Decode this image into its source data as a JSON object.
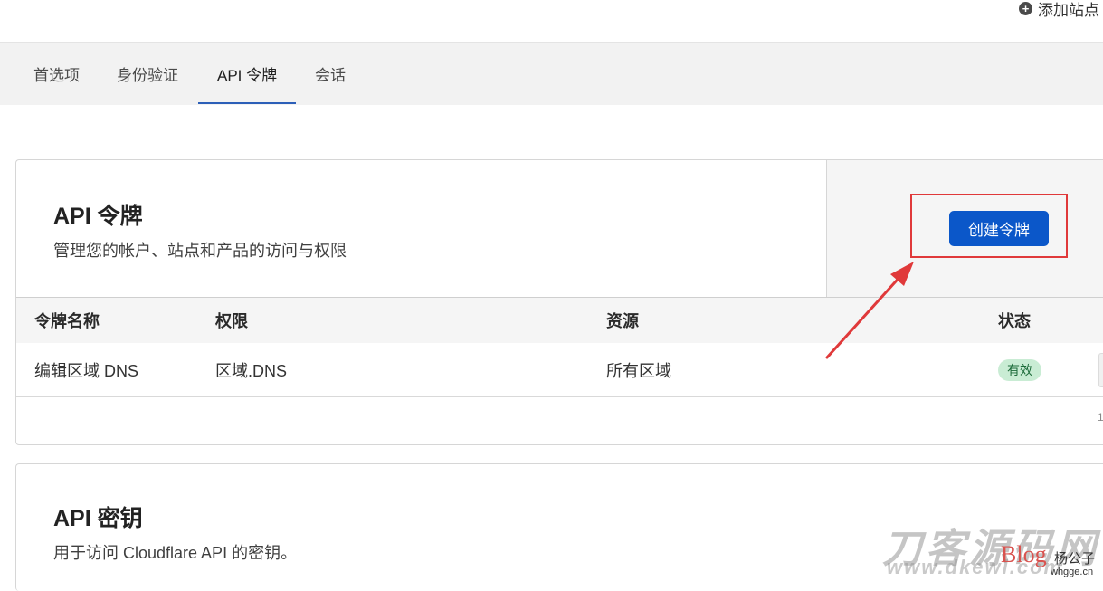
{
  "topbar": {
    "add_site_label": "添加站点"
  },
  "tabs": [
    {
      "label": "首选项"
    },
    {
      "label": "身份验证"
    },
    {
      "label": "API 令牌",
      "active": true
    },
    {
      "label": "会话"
    }
  ],
  "api_tokens": {
    "title": "API 令牌",
    "subtitle": "管理您的帐户、站点和产品的访问与权限",
    "create_button": "创建令牌",
    "columns": [
      "令牌名称",
      "权限",
      "资源",
      "状态"
    ],
    "rows": [
      {
        "name": "编辑区域 DNS",
        "permission": "区域.DNS",
        "resource": "所有区域",
        "status": "有效"
      }
    ],
    "footer_fragment": "1"
  },
  "api_keys": {
    "title": "API 密钥",
    "subtitle": "用于访问 Cloudflare API 的密钥。"
  },
  "annotation": {
    "color": "#e0393a"
  },
  "watermark": {
    "site_name": "刀客源码网",
    "url": "www.dkewl.com",
    "blog_label": "Blog",
    "author": "杨公子",
    "domain": "whgge.cn"
  },
  "colors": {
    "primary": "#0b57c9",
    "badge_bg": "#c9ecd4",
    "badge_text": "#1d6b3a"
  }
}
